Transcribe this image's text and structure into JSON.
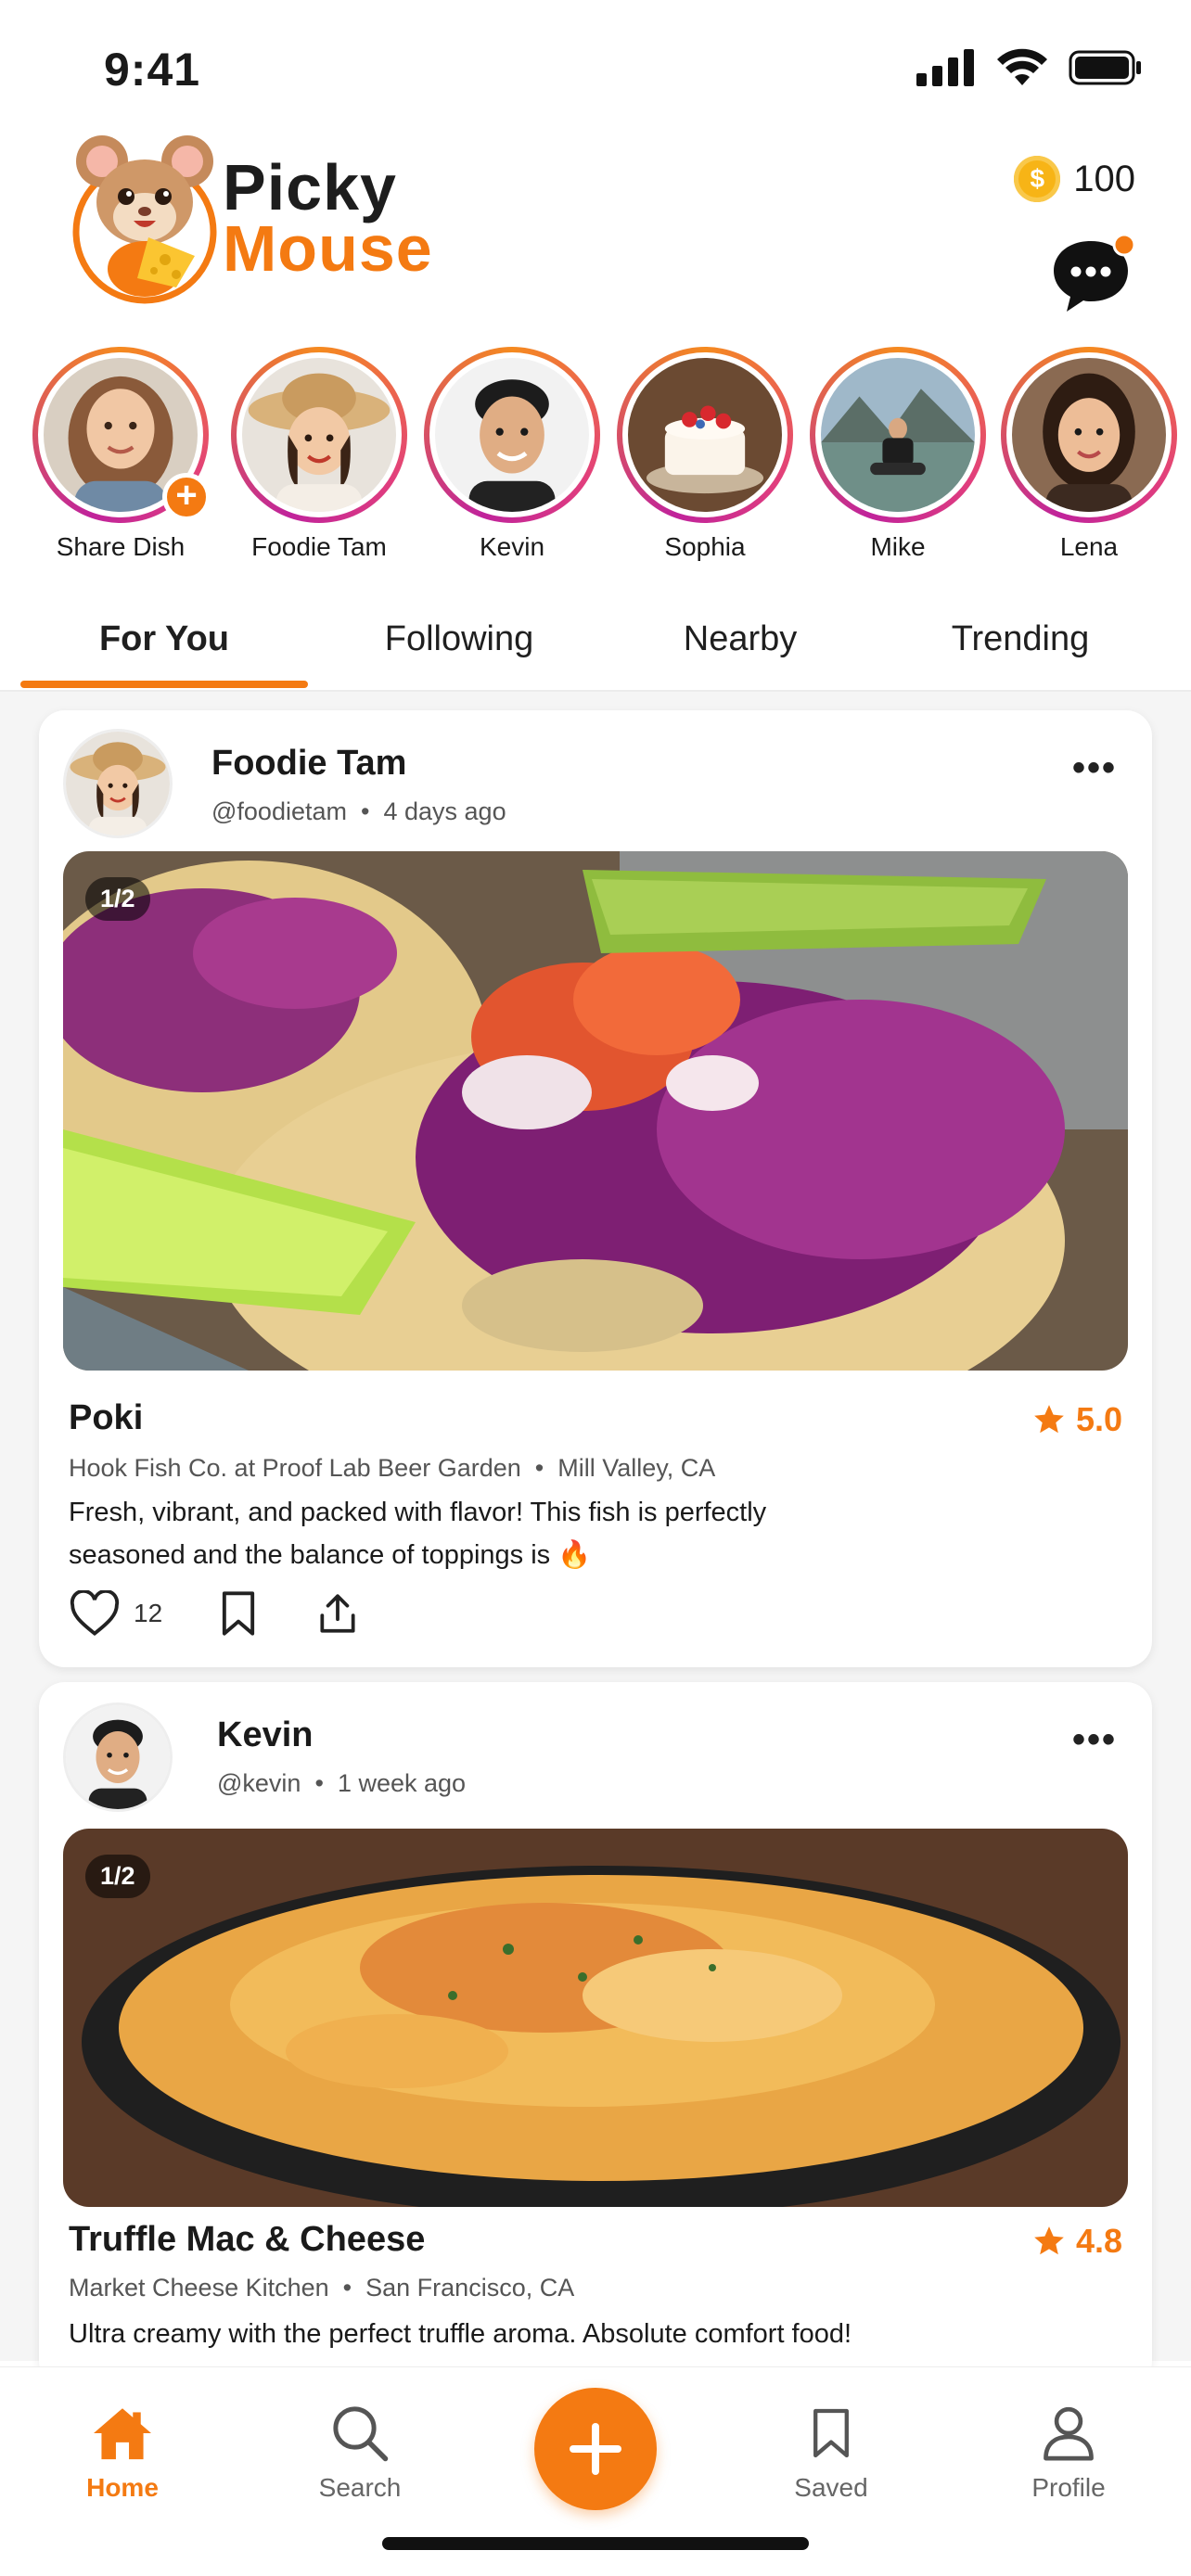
{
  "status": {
    "time": "9:41"
  },
  "header": {
    "logo_line1": "Picky",
    "logo_line2": "Mouse",
    "coins": "100",
    "has_notification": true
  },
  "stories": [
    {
      "label": "Share Dish",
      "is_self": true
    },
    {
      "label": "Foodie Tam"
    },
    {
      "label": "Kevin"
    },
    {
      "label": "Sophia"
    },
    {
      "label": "Mike"
    },
    {
      "label": "Lena"
    }
  ],
  "tabs": [
    {
      "label": "For You",
      "active": true
    },
    {
      "label": "Following"
    },
    {
      "label": "Nearby"
    },
    {
      "label": "Trending"
    }
  ],
  "posts": [
    {
      "author": "Foodie Tam",
      "handle": "@foodietam",
      "time": "4 days ago",
      "photo_count": "1/2",
      "dish": "Poki",
      "rating": "5.0",
      "restaurant": "Hook Fish Co. at Proof Lab Beer Garden",
      "location": "Mill Valley, CA",
      "review_line1": "Fresh, vibrant, and packed with flavor! This fish is perfectly",
      "review_line2": "seasoned and the balance of toppings is 🔥",
      "likes": "12"
    },
    {
      "author": "Kevin",
      "handle": "@kevin",
      "time": "1 week ago",
      "photo_count": "1/2",
      "dish": "Truffle Mac & Cheese",
      "rating": "4.8",
      "restaurant": "Market Cheese Kitchen",
      "location": "San Francisco, CA",
      "review_line1": "Ultra creamy with the perfect truffle aroma. Absolute comfort food!"
    }
  ],
  "nav": {
    "home": "Home",
    "search": "Search",
    "saved": "Saved",
    "profile": "Profile"
  },
  "colors": {
    "accent": "#f47a12",
    "ring_pink": "#e23f7c"
  }
}
